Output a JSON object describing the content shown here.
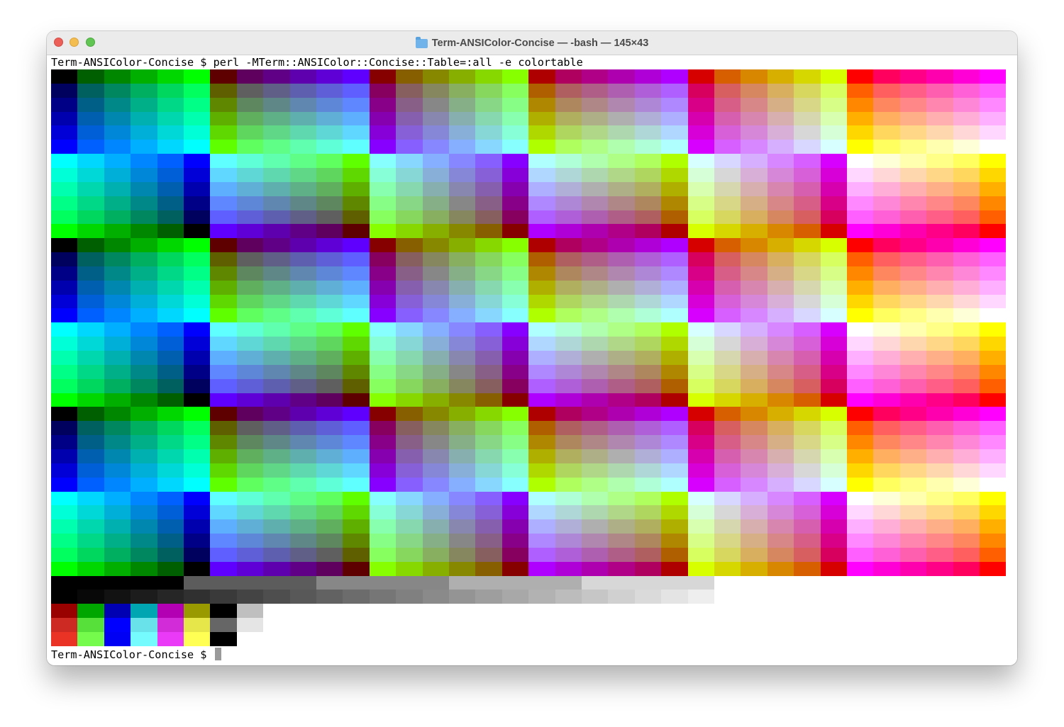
{
  "window": {
    "title": "Term-ANSIColor-Concise — -bash — 145×43",
    "folder_icon": "folder-icon"
  },
  "terminal": {
    "command_line": "Term-ANSIColor-Concise $ perl -MTerm::ANSIColor::Concise::Table=:all -e colortable",
    "prompt_line": "Term-ANSIColor-Concise $ "
  },
  "palette": {
    "cube_levels": [
      0,
      95,
      135,
      175,
      215,
      255
    ],
    "base16": [
      "#000000",
      "#990000",
      "#00a600",
      "#999900",
      "#0000b2",
      "#b200b2",
      "#00a6b2",
      "#bfbfbf",
      "#666666",
      "#e50000",
      "#00d900",
      "#e5e500",
      "#0000ff",
      "#e500e5",
      "#00e5e5",
      "#e5e5e5"
    ]
  },
  "colors": {
    "window_bg": "#ffffff",
    "titlebar_bg": "#ecebec",
    "traffic_close": "#ec5f59",
    "traffic_min": "#f4bd4f",
    "traffic_max": "#61c554"
  }
}
